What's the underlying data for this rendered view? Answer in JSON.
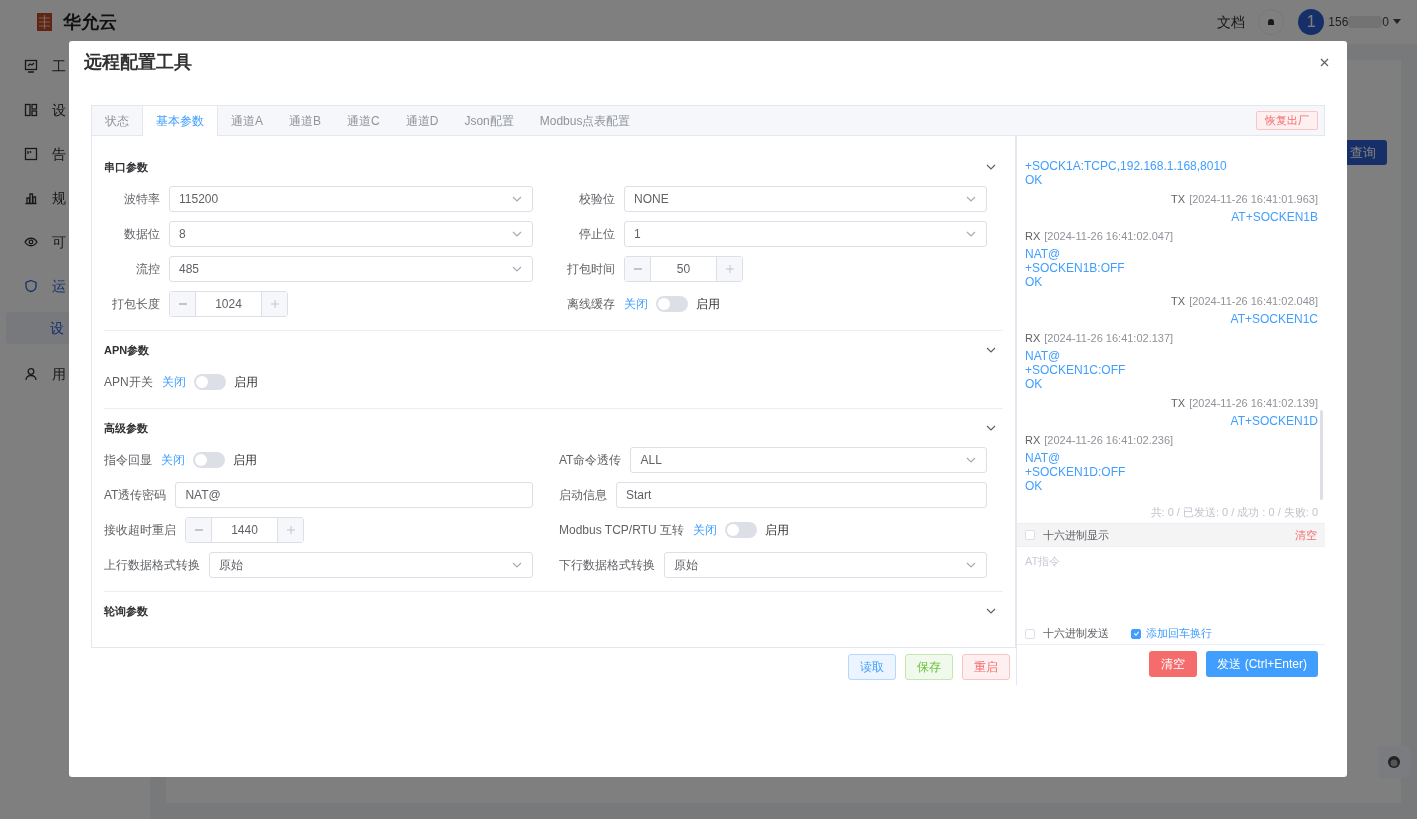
{
  "app": {
    "logo_text": "华允云",
    "header": {
      "docs_link": "文档",
      "avatar_initial": "1",
      "user_start": "156",
      "user_end": "0"
    },
    "sidebar": [
      {
        "label": "工",
        "selected": false
      },
      {
        "label": "设",
        "selected": false
      },
      {
        "label": "告",
        "selected": false
      },
      {
        "label": "规",
        "selected": false
      },
      {
        "label": "可",
        "selected": false
      },
      {
        "label": "运",
        "selected": false,
        "expanded": true,
        "children": [
          {
            "label": "设",
            "selected": true
          }
        ]
      },
      {
        "label": "用",
        "selected": false
      }
    ],
    "query_button": "查询"
  },
  "dialog": {
    "title": "远程配置工具",
    "tabs": [
      {
        "label": "状态",
        "selected": false
      },
      {
        "label": "基本参数",
        "selected": true
      },
      {
        "label": "通道A",
        "selected": false
      },
      {
        "label": "通道B",
        "selected": false
      },
      {
        "label": "通道C",
        "selected": false
      },
      {
        "label": "通道D",
        "selected": false
      },
      {
        "label": "Json配置",
        "selected": false
      },
      {
        "label": "Modbus点表配置",
        "selected": false
      }
    ],
    "restore_button": "恢复出厂",
    "sections": [
      {
        "title": "串口参数",
        "expanded": true,
        "fields": [
          {
            "kind": "select",
            "label": "波特率",
            "value": "115200"
          },
          {
            "kind": "select",
            "label": "校验位",
            "value": "NONE"
          },
          {
            "kind": "select",
            "label": "数据位",
            "value": "8"
          },
          {
            "kind": "select",
            "label": "停止位",
            "value": "1"
          },
          {
            "kind": "select",
            "label": "流控",
            "value": "485"
          },
          {
            "kind": "stepper",
            "label": "打包时间",
            "value": "50"
          },
          {
            "kind": "stepper",
            "label": "打包长度",
            "value": "1024"
          },
          {
            "kind": "switch",
            "label": "离线缓存",
            "off_label": "关闭",
            "on_label": "启用",
            "on": false
          }
        ]
      },
      {
        "title": "APN参数",
        "expanded": true,
        "fields": [
          {
            "kind": "switch",
            "label": "APN开关",
            "off_label": "关闭",
            "on_label": "启用",
            "on": false
          }
        ]
      },
      {
        "title": "高级参数",
        "expanded": true,
        "fields": [
          {
            "kind": "switch",
            "label": "指令回显",
            "off_label": "关闭",
            "on_label": "启用",
            "on": false
          },
          {
            "kind": "select",
            "label": "AT命令透传",
            "value": "ALL"
          },
          {
            "kind": "text",
            "label": "AT透传密码",
            "value": "NAT@"
          },
          {
            "kind": "text",
            "label": "启动信息",
            "value": "Start"
          },
          {
            "kind": "stepper",
            "label": "接收超时重启",
            "value": "1440"
          },
          {
            "kind": "switch",
            "label": "Modbus TCP/RTU 互转",
            "off_label": "关闭",
            "on_label": "启用",
            "on": false
          },
          {
            "kind": "select",
            "label": "上行数据格式转换",
            "value": "原始"
          },
          {
            "kind": "select",
            "label": "下行数据格式转换",
            "value": "原始"
          }
        ]
      },
      {
        "title": "轮询参数",
        "expanded": true
      }
    ],
    "form_buttons": [
      {
        "label": "读取",
        "kind": "primary"
      },
      {
        "label": "保存",
        "kind": "success"
      },
      {
        "label": "重启",
        "kind": "danger"
      }
    ],
    "log": {
      "entries": [
        {
          "kind": "rx",
          "lines": [
            "+SOCK1A:TCPC,192.168.1.168,8010",
            "OK"
          ]
        },
        {
          "kind": "tx",
          "direction": "TX",
          "time": "[2024-11-26 16:41:01.963]",
          "lines": [
            "AT+SOCKEN1B"
          ]
        },
        {
          "kind": "rx",
          "direction": "RX",
          "time": "[2024-11-26 16:41:02.047]",
          "lines": [
            "NAT@",
            "+SOCKEN1B:OFF",
            "OK"
          ]
        },
        {
          "kind": "tx",
          "direction": "TX",
          "time": "[2024-11-26 16:41:02.048]",
          "lines": [
            "AT+SOCKEN1C"
          ]
        },
        {
          "kind": "rx",
          "direction": "RX",
          "time": "[2024-11-26 16:41:02.137]",
          "lines": [
            "NAT@",
            "+SOCKEN1C:OFF",
            "OK"
          ]
        },
        {
          "kind": "tx",
          "direction": "TX",
          "time": "[2024-11-26 16:41:02.139]",
          "lines": [
            "AT+SOCKEN1D"
          ]
        },
        {
          "kind": "rx",
          "direction": "RX",
          "time": "[2024-11-26 16:41:02.236]",
          "lines": [
            "NAT@",
            "+SOCKEN1D:OFF",
            "OK"
          ]
        }
      ],
      "stats": "共: 0 / 已发送: 0 / 成功 : 0 / 失败: 0",
      "hex_display": {
        "label": "十六进制显示",
        "checked": false
      },
      "clear_link": "清空",
      "input": {
        "placeholder": "AT指令"
      },
      "hex_send": {
        "label": "十六进制发送",
        "checked": false
      },
      "add_crlf": {
        "label": "添加回车换行",
        "checked": true
      },
      "clear_button": "清空",
      "send_button": "发送 (Ctrl+Enter)"
    }
  }
}
